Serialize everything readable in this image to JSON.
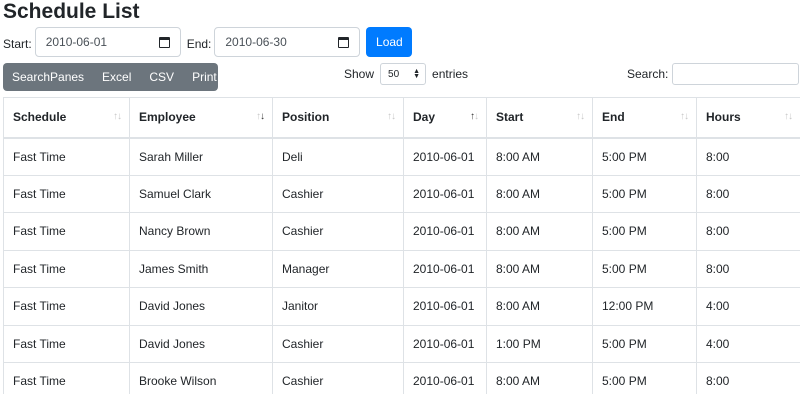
{
  "page": {
    "title": "Schedule List"
  },
  "filters": {
    "start_label": "Start:",
    "start_value": "2010-06-01",
    "end_label": "End:",
    "end_value": "2010-06-30",
    "load_label": "Load"
  },
  "buttons": [
    "SearchPanes",
    "Excel",
    "CSV",
    "Print"
  ],
  "length": {
    "show_label": "Show",
    "value": "50",
    "entries_label": "entries"
  },
  "search": {
    "label": "Search:",
    "value": ""
  },
  "table": {
    "columns": [
      "Schedule",
      "Employee",
      "Position",
      "Day",
      "Start",
      "End",
      "Hours"
    ],
    "sorted_column": "Day",
    "rows": [
      [
        "Fast Time",
        "Sarah Miller",
        "Deli",
        "2010-06-01",
        "8:00 AM",
        "5:00 PM",
        "8:00"
      ],
      [
        "Fast Time",
        "Samuel Clark",
        "Cashier",
        "2010-06-01",
        "8:00 AM",
        "5:00 PM",
        "8:00"
      ],
      [
        "Fast Time",
        "Nancy Brown",
        "Cashier",
        "2010-06-01",
        "8:00 AM",
        "5:00 PM",
        "8:00"
      ],
      [
        "Fast Time",
        "James Smith",
        "Manager",
        "2010-06-01",
        "8:00 AM",
        "5:00 PM",
        "8:00"
      ],
      [
        "Fast Time",
        "David Jones",
        "Janitor",
        "2010-06-01",
        "8:00 AM",
        "12:00 PM",
        "4:00"
      ],
      [
        "Fast Time",
        "David Jones",
        "Cashier",
        "2010-06-01",
        "1:00 PM",
        "5:00 PM",
        "4:00"
      ],
      [
        "Fast Time",
        "Brooke Wilson",
        "Cashier",
        "2010-06-01",
        "8:00 AM",
        "5:00 PM",
        "8:00"
      ]
    ]
  },
  "colors": {
    "primary": "#007bff",
    "secondary": "#6c757d"
  }
}
